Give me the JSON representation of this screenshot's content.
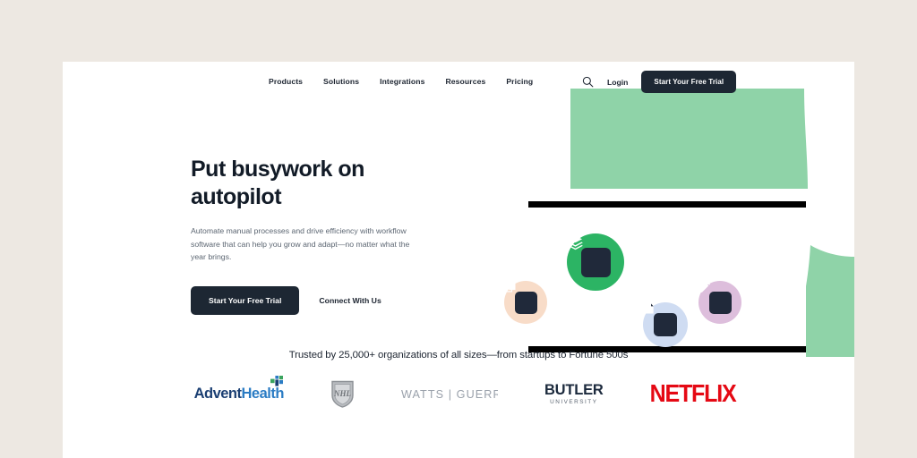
{
  "theme": {
    "page_background": "#ffffff",
    "outer_background": "#ede8e2",
    "ink": "#1c2430",
    "dark_button": "#1d2733",
    "green_accent": "#8fd3a8",
    "green_circle": "#2cb464",
    "peach_circle": "#f8dcc8",
    "blue_circle": "#cfdcf2",
    "lavender_circle": "#ddbedc",
    "netflix_red": "#e50914"
  },
  "nav": {
    "links": [
      {
        "label": "Products"
      },
      {
        "label": "Solutions"
      },
      {
        "label": "Integrations"
      },
      {
        "label": "Resources"
      },
      {
        "label": "Pricing"
      }
    ],
    "search_icon": "search-icon",
    "login_label": "Login",
    "cta_label": "Start Your Free Trial"
  },
  "hero": {
    "headline": "Put busywork on autopilot",
    "subhead": "Automate manual processes and drive efficiency with workflow software that can help you grow and adapt—no matter what the year brings.",
    "primary_cta": "Start Your Free Trial",
    "secondary_cta": "Connect With Us"
  },
  "illustration": {
    "circles": [
      {
        "name": "layers-icon",
        "color": "#2cb464"
      },
      {
        "name": "copy-icon",
        "color": "#f8dcc8"
      },
      {
        "name": "document-icon",
        "color": "#cfdcf2"
      },
      {
        "name": "pencil-icon",
        "color": "#ddbedc"
      }
    ]
  },
  "trust": {
    "text": "Trusted by 25,000+ organizations of all sizes—from startups to Fortune 500s",
    "logos": {
      "adventhealth": {
        "part1": "Advent",
        "part2": "Health"
      },
      "nhl": "NHL",
      "watts_guerra": "WATTS | GUERRA",
      "butler": {
        "name": "BUTLER",
        "sub": "UNIVERSITY"
      },
      "netflix": "NETFLIX"
    }
  }
}
